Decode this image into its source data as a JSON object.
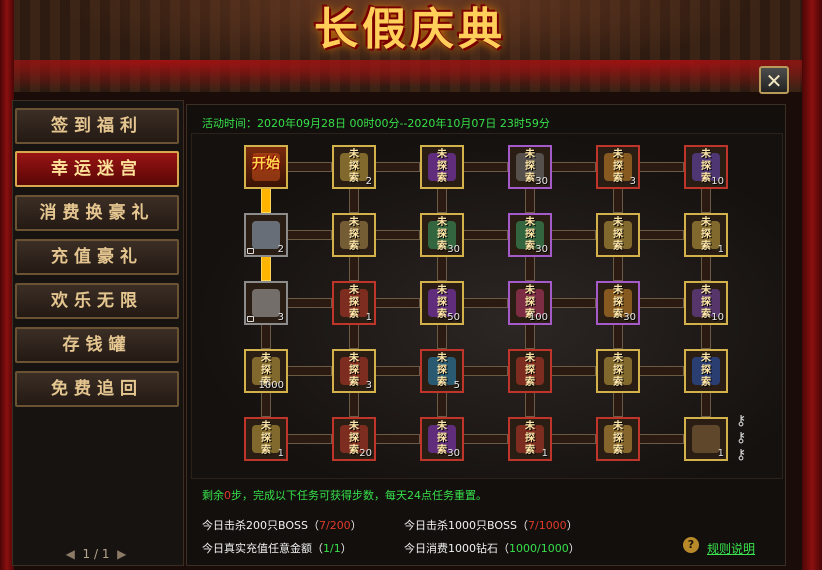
{
  "title": "长假庆典",
  "close_label": "✕",
  "sidebar": {
    "items": [
      {
        "label": "签到福利",
        "active": false
      },
      {
        "label": "幸运迷宫",
        "active": true
      },
      {
        "label": "消费换豪礼",
        "active": false
      },
      {
        "label": "充值豪礼",
        "active": false
      },
      {
        "label": "欢乐无限",
        "active": false
      },
      {
        "label": "存钱罐",
        "active": false
      },
      {
        "label": "免费追回",
        "active": false
      }
    ],
    "pager": {
      "prev": "◀",
      "text": "1 / 1",
      "next": "▶"
    }
  },
  "activity_time": "活动时间：2020年09月28日 00时00分--2020年10月07日 23时59分",
  "board": {
    "start_label": "开始",
    "unexplored_label": "未\n探\n索",
    "rows": [
      [
        {
          "state": "start",
          "rarity": "gold",
          "color": "#c8501a"
        },
        {
          "state": "unexplored",
          "rarity": "gold",
          "count": "2",
          "color": "#c9a640"
        },
        {
          "state": "unexplored",
          "rarity": "gold",
          "count": "",
          "color": "#8a3ad0"
        },
        {
          "state": "unexplored",
          "rarity": "purple",
          "count": "30",
          "color": "#7a7a7a"
        },
        {
          "state": "unexplored",
          "rarity": "red",
          "count": "3",
          "color": "#d08a2a"
        },
        {
          "state": "unexplored",
          "rarity": "red",
          "count": "10",
          "color": "#6a4ac0"
        }
      ],
      [
        {
          "state": "open",
          "rarity": "gray",
          "count": "2",
          "color": "#9ab0c8",
          "locked": true
        },
        {
          "state": "unexplored",
          "rarity": "gold",
          "count": "",
          "color": "#b09050"
        },
        {
          "state": "unexplored",
          "rarity": "gold",
          "count": "30",
          "color": "#3aa060"
        },
        {
          "state": "unexplored",
          "rarity": "purple",
          "count": "30",
          "color": "#3aa060"
        },
        {
          "state": "unexplored",
          "rarity": "gold",
          "count": "",
          "color": "#c9a640"
        },
        {
          "state": "unexplored",
          "rarity": "gold",
          "count": "1",
          "color": "#c9a640"
        }
      ],
      [
        {
          "state": "open",
          "rarity": "gray",
          "count": "3",
          "color": "#b0b0b0",
          "locked": true
        },
        {
          "state": "unexplored",
          "rarity": "red",
          "count": "1",
          "color": "#c03a2a"
        },
        {
          "state": "unexplored",
          "rarity": "gold",
          "count": "50",
          "color": "#8a3ad0"
        },
        {
          "state": "unexplored",
          "rarity": "purple",
          "count": "100",
          "color": "#c03a6a"
        },
        {
          "state": "unexplored",
          "rarity": "purple",
          "count": "30",
          "color": "#d08a2a"
        },
        {
          "state": "unexplored",
          "rarity": "gold",
          "count": "10",
          "color": "#7a4ab0"
        }
      ],
      [
        {
          "state": "unexplored",
          "rarity": "gold",
          "count": "1000",
          "color": "#c9a640"
        },
        {
          "state": "unexplored",
          "rarity": "gold",
          "count": "3",
          "color": "#c03a2a"
        },
        {
          "state": "unexplored",
          "rarity": "red",
          "count": "5",
          "color": "#2a8ac0"
        },
        {
          "state": "unexplored",
          "rarity": "red",
          "count": "",
          "color": "#c03a2a"
        },
        {
          "state": "unexplored",
          "rarity": "gold",
          "count": "",
          "color": "#c9a640"
        },
        {
          "state": "unexplored",
          "rarity": "gold",
          "count": "",
          "color": "#2a5ac0"
        }
      ],
      [
        {
          "state": "unexplored",
          "rarity": "red",
          "count": "1",
          "color": "#c9a640"
        },
        {
          "state": "unexplored",
          "rarity": "red",
          "count": "20",
          "color": "#c03a2a"
        },
        {
          "state": "unexplored",
          "rarity": "red",
          "count": "30",
          "color": "#8a3ad0"
        },
        {
          "state": "unexplored",
          "rarity": "red",
          "count": "1",
          "color": "#c03a2a"
        },
        {
          "state": "unexplored",
          "rarity": "red",
          "count": "",
          "color": "#d0a040"
        },
        {
          "state": "open",
          "rarity": "gold",
          "count": "1",
          "color": "#8a6a40"
        }
      ]
    ],
    "vertical_links_lit": [
      "0-0",
      "1-0"
    ]
  },
  "info": {
    "prefix": "剩余",
    "steps": "0",
    "suffix": "步，完成以下任务可获得步数，每天24点任务重置。"
  },
  "tasks": [
    {
      "label": "今日击杀200只BOSS（",
      "progress": "7/200",
      "end": "）",
      "status": "red"
    },
    {
      "label": "今日击杀1000只BOSS（",
      "progress": "7/1000",
      "end": "）",
      "status": "red"
    },
    {
      "label": "今日真实充值任意金额（",
      "progress": "1/1",
      "end": "）",
      "status": "green"
    },
    {
      "label": "今日消费1000钻石（",
      "progress": "1000/1000",
      "end": "）",
      "status": "green"
    }
  ],
  "help": {
    "icon": "?",
    "label": "规则说明"
  },
  "keys_icon": "key-icon"
}
